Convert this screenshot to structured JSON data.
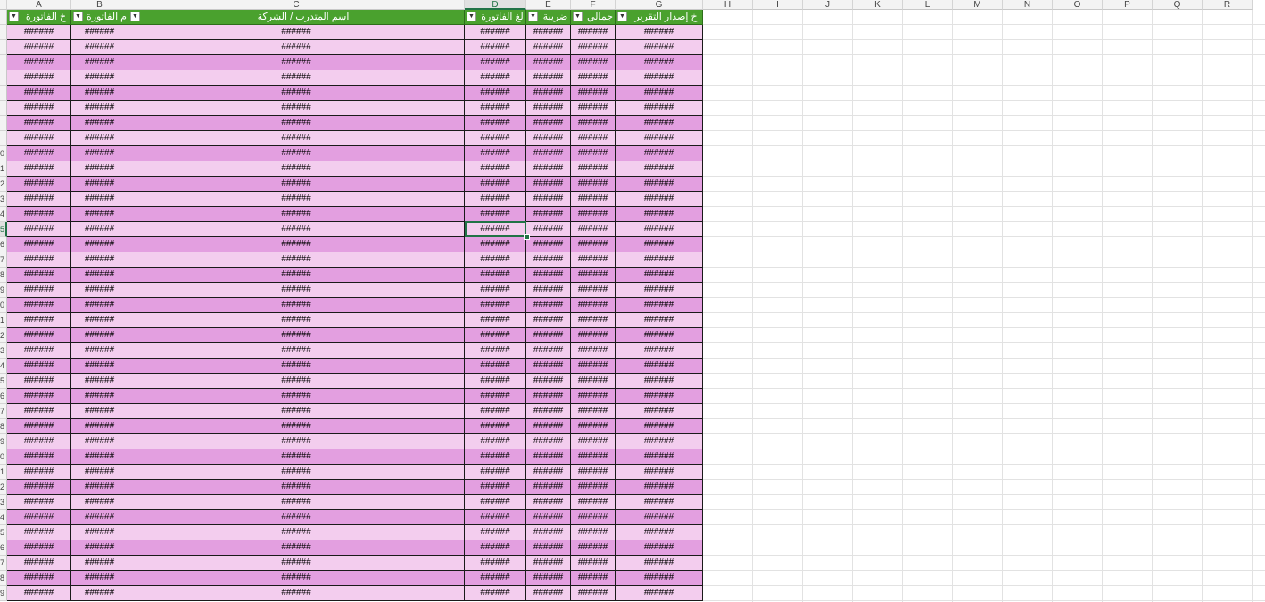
{
  "columns": [
    "A",
    "B",
    "C",
    "D",
    "E",
    "F",
    "G",
    "H",
    "I",
    "J",
    "K",
    "L",
    "M",
    "N",
    "O",
    "P",
    "Q",
    "R"
  ],
  "selected_column": "D",
  "selected_row": "5",
  "table_headers": [
    "خ الفاتورة",
    "م الفاتورة",
    "اسم المتدرب / الشركة",
    "لغ الفاتورة",
    "ضريبة",
    "جمالي",
    "خ إصدار التقرير"
  ],
  "row_numbers": [
    "",
    "",
    "",
    "",
    "",
    "",
    "",
    "",
    "0",
    "1",
    "2",
    "3",
    "4",
    "5",
    "6",
    "7",
    "8",
    "9",
    "0",
    "1",
    "2",
    "3",
    "4",
    "5",
    "6",
    "7",
    "8",
    "9",
    "0",
    "1",
    "2",
    "3",
    "4",
    "5",
    "6",
    "7",
    "8",
    "9"
  ],
  "overflow_text": "######",
  "row_shading": [
    "light",
    "light",
    "dark",
    "light",
    "dark",
    "light",
    "dark",
    "light",
    "dark",
    "light",
    "dark",
    "light",
    "dark",
    "light",
    "dark",
    "light",
    "dark",
    "light",
    "dark",
    "light",
    "dark",
    "light",
    "dark",
    "light",
    "dark",
    "light",
    "dark",
    "light",
    "dark",
    "light",
    "dark",
    "light",
    "dark",
    "light",
    "dark",
    "light",
    "dark",
    "light"
  ],
  "colors": {
    "header_green": "#4aa12e",
    "row_dark": "#e39fe0",
    "row_light": "#f3cdee",
    "selection": "#217346"
  },
  "icons": {
    "filter": "filter-dropdown-icon"
  }
}
